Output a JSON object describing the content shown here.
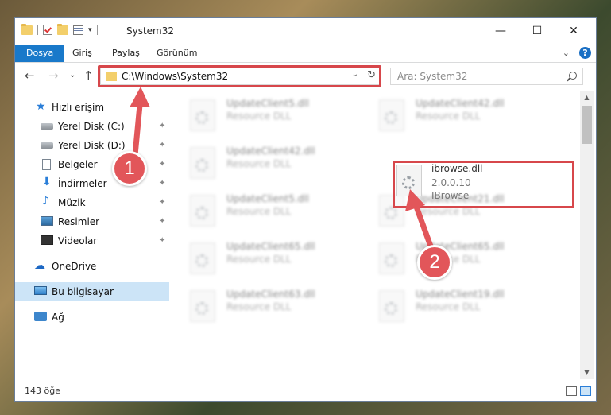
{
  "window": {
    "title": "System32",
    "controls": {
      "minimize": "—",
      "maximize": "☐",
      "close": "✕"
    }
  },
  "ribbon": {
    "tabs": [
      "Dosya",
      "Giriş",
      "Paylaş",
      "Görünüm"
    ],
    "active_tab": "Dosya",
    "help": "?",
    "collapse": "⌄"
  },
  "nav": {
    "back": "←",
    "forward": "→",
    "recent": "⌄",
    "up": "↑"
  },
  "address": {
    "path": "C:\\Windows\\System32",
    "dropdown": "⌄",
    "refresh": "↻"
  },
  "search": {
    "placeholder": "Ara: System32"
  },
  "sidebar": {
    "items": [
      {
        "label": "Hızlı erişim",
        "icon": "star-icon"
      },
      {
        "label": "Yerel Disk (C:)",
        "icon": "disk-icon",
        "pinned": true
      },
      {
        "label": "Yerel Disk (D:)",
        "icon": "disk-icon",
        "pinned": true
      },
      {
        "label": "Belgeler",
        "icon": "document-icon",
        "pinned": true
      },
      {
        "label": "İndirmeler",
        "icon": "download-icon",
        "pinned": true
      },
      {
        "label": "Müzik",
        "icon": "music-icon",
        "pinned": true
      },
      {
        "label": "Resimler",
        "icon": "pictures-icon",
        "pinned": true
      },
      {
        "label": "Videolar",
        "icon": "video-icon",
        "pinned": true
      },
      {
        "label": "OneDrive",
        "icon": "cloud-icon"
      },
      {
        "label": "Bu bilgisayar",
        "icon": "computer-icon",
        "selected": true
      },
      {
        "label": "Ağ",
        "icon": "network-icon"
      }
    ],
    "pin_glyph": "📌"
  },
  "files": {
    "left_column": [
      {
        "name": "UpdateClient5.dll",
        "desc": "Resource DLL"
      },
      {
        "name": "UpdateClient42.dll",
        "desc": "Resource DLL"
      },
      {
        "name": "UpdateClient5.dll",
        "desc": "Resource DLL"
      },
      {
        "name": "UpdateClient65.dll",
        "desc": "Resource DLL"
      },
      {
        "name": "UpdateClient63.dll",
        "desc": "Resource DLL"
      }
    ],
    "right_column": [
      {
        "name": "UpdateClient42.dll",
        "desc": "Resource DLL"
      },
      {
        "name": "UpdateClient21.dll",
        "desc": "Resource DLL"
      },
      {
        "name": "UpdateClient65.dll",
        "desc": "Resource DLL"
      },
      {
        "name": "UpdateClient19.dll",
        "desc": "Resource DLL"
      }
    ],
    "highlighted": {
      "name": "ibrowse.dll",
      "version": "2.0.0.10",
      "desc": "IBrowse"
    }
  },
  "annotations": {
    "step1": "1",
    "step2": "2",
    "color": "#e2565a"
  },
  "status": {
    "item_count": "143 öğe"
  },
  "colors": {
    "accent": "#1979ca",
    "highlight": "#d7474b",
    "selected": "#cce4f7"
  }
}
